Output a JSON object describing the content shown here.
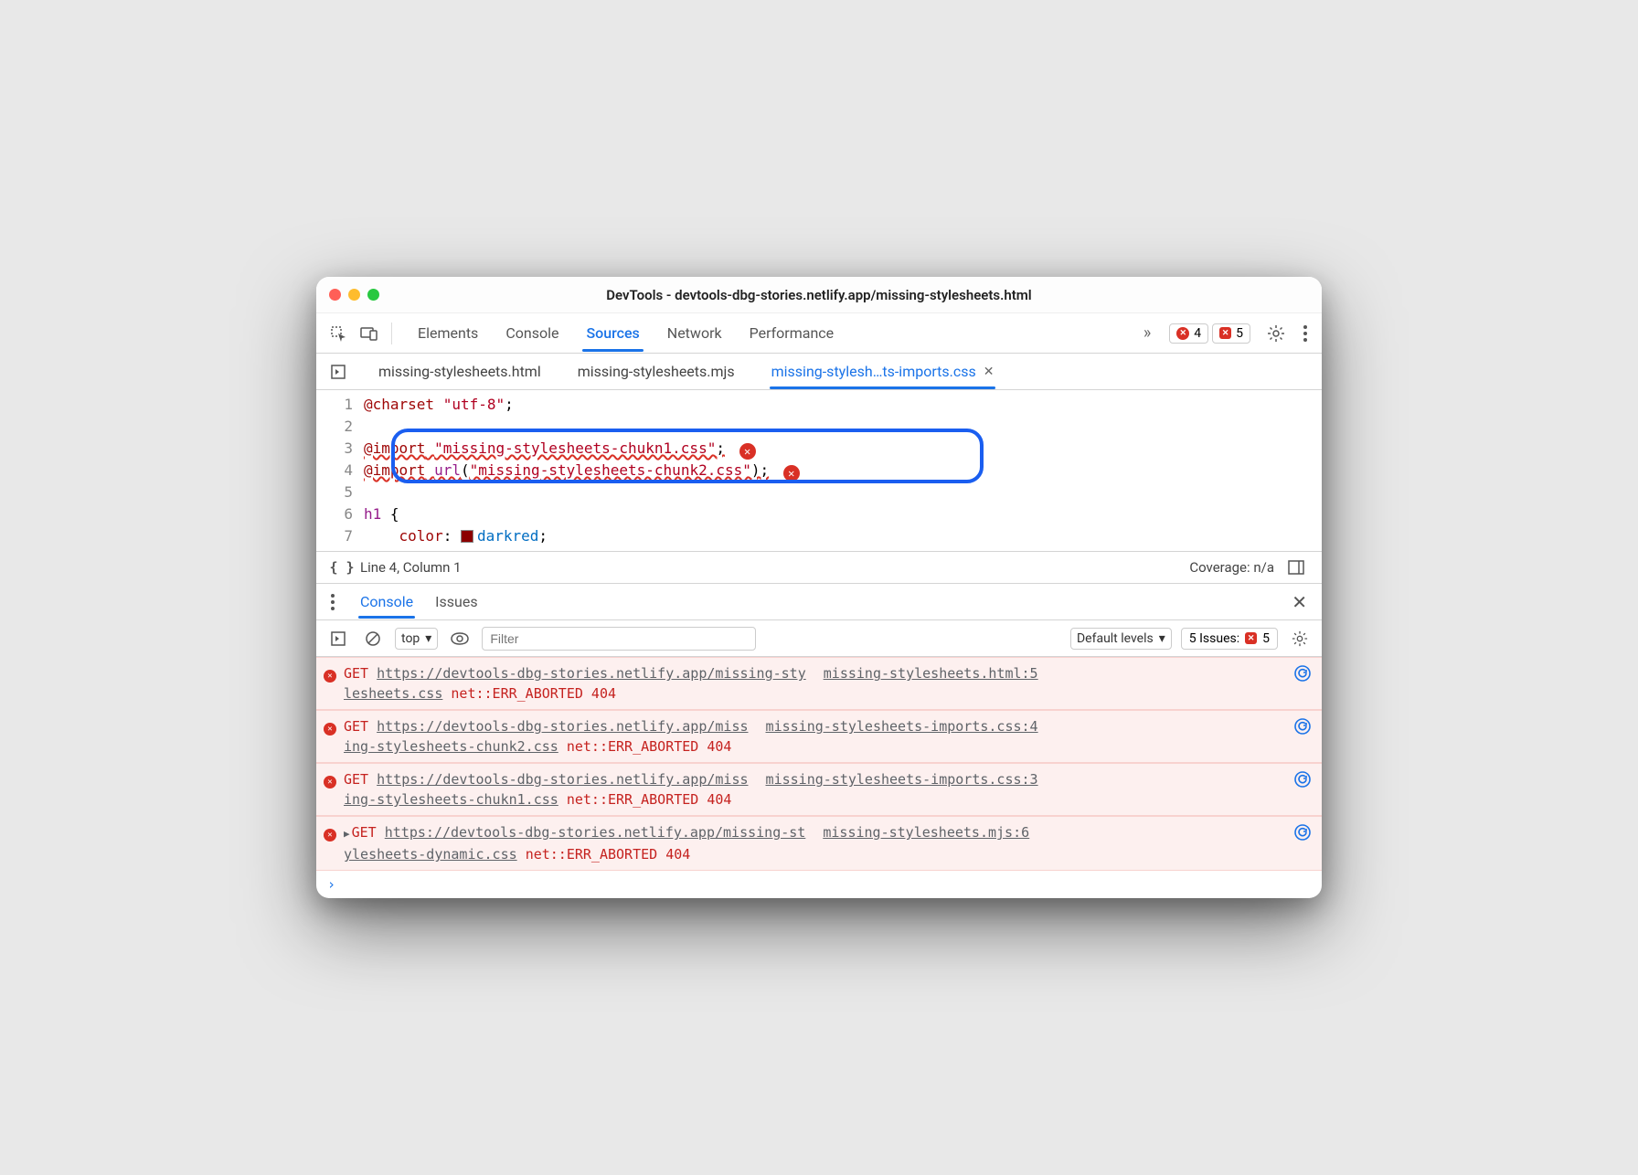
{
  "window": {
    "title": "DevTools - devtools-dbg-stories.netlify.app/missing-stylesheets.html"
  },
  "mainTabs": {
    "items": [
      "Elements",
      "Console",
      "Sources",
      "Network",
      "Performance"
    ],
    "activeIndex": 2,
    "overflow": "»",
    "errorCount": "4",
    "issueCount": "5"
  },
  "fileTabs": {
    "items": [
      "missing-stylesheets.html",
      "missing-stylesheets.mjs",
      "missing-stylesh…ts-imports.css"
    ],
    "activeIndex": 2
  },
  "code": {
    "lines": [
      {
        "n": "1",
        "html": "<span class='atkw'>@charset</span> <span class='str'>\"utf-8\"</span>;"
      },
      {
        "n": "2",
        "html": ""
      },
      {
        "n": "3",
        "html": "<span class='wavy'><span class='atkw'>@import</span> <span class='str'>\"missing-stylesheets-chukn1.css\"</span>;</span> <span class='err-inline'>✕</span>"
      },
      {
        "n": "4",
        "html": "<span class='wavy'><span class='atkw'>@import</span> <span class='sel'>url</span>(<span class='str'>\"missing-stylesheets-chunk2.css\"</span>);</span> <span class='err-inline'>✕</span>"
      },
      {
        "n": "5",
        "html": ""
      },
      {
        "n": "6",
        "html": "<span class='sel'>h1</span> {"
      },
      {
        "n": "7",
        "html": "&nbsp;&nbsp;&nbsp;&nbsp;<span class='prop'>color</span>: <span class='swatch'></span><span class='val'>darkred</span>;"
      }
    ]
  },
  "statusBar": {
    "position": "Line 4, Column 1",
    "coverage": "Coverage: n/a"
  },
  "subTabs": {
    "items": [
      "Console",
      "Issues"
    ],
    "activeIndex": 0
  },
  "consoleToolbar": {
    "context": "top",
    "filterPlaceholder": "Filter",
    "levels": "Default levels",
    "issuesLabel": "5 Issues:",
    "issuesCount": "5"
  },
  "consoleLogs": [
    {
      "type": "error",
      "method": "GET",
      "url": "https://devtools-dbg-stories.netlify.app/missing-stylesheets.css",
      "urlLine1": "https://devtools-dbg-stories.netlify.app/missing-sty",
      "urlLine2": "lesheets.css",
      "status": "net::ERR_ABORTED 404",
      "source": "missing-stylesheets.html:5",
      "expandable": false
    },
    {
      "type": "error",
      "method": "GET",
      "url": "https://devtools-dbg-stories.netlify.app/missing-stylesheets-chunk2.css",
      "urlLine1": "https://devtools-dbg-stories.netlify.app/miss",
      "urlLine2": "ing-stylesheets-chunk2.css",
      "status": "net::ERR_ABORTED 404",
      "source": "missing-stylesheets-imports.css:4",
      "expandable": false
    },
    {
      "type": "error",
      "method": "GET",
      "url": "https://devtools-dbg-stories.netlify.app/missing-stylesheets-chukn1.css",
      "urlLine1": "https://devtools-dbg-stories.netlify.app/miss",
      "urlLine2": "ing-stylesheets-chukn1.css",
      "status": "net::ERR_ABORTED 404",
      "source": "missing-stylesheets-imports.css:3",
      "expandable": false
    },
    {
      "type": "error",
      "method": "GET",
      "url": "https://devtools-dbg-stories.netlify.app/missing-stylesheets-dynamic.css",
      "urlLine1": "https://devtools-dbg-stories.netlify.app/missing-st",
      "urlLine2": "ylesheets-dynamic.css",
      "status": "net::ERR_ABORTED 404",
      "source": "missing-stylesheets.mjs:6",
      "expandable": true
    }
  ],
  "prompt": "›"
}
